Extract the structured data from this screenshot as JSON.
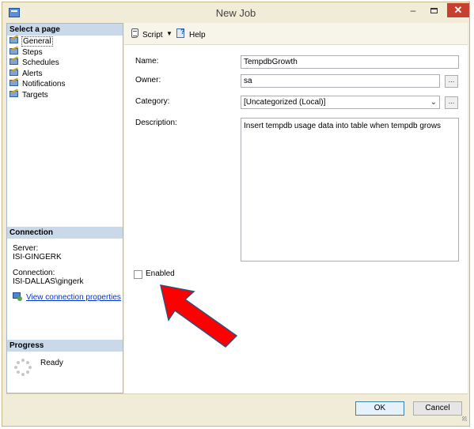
{
  "window": {
    "title": "New Job"
  },
  "title_buttons": {
    "minimize": "–",
    "close": "✕"
  },
  "sidebar": {
    "select_page_header": "Select a page",
    "pages": [
      {
        "label": "General",
        "selected": true
      },
      {
        "label": "Steps",
        "selected": false
      },
      {
        "label": "Schedules",
        "selected": false
      },
      {
        "label": "Alerts",
        "selected": false
      },
      {
        "label": "Notifications",
        "selected": false
      },
      {
        "label": "Targets",
        "selected": false
      }
    ],
    "connection": {
      "header": "Connection",
      "server_label": "Server:",
      "server_value": "ISI-GINGERK",
      "connection_label": "Connection:",
      "connection_value": "ISI-DALLAS\\gingerk",
      "link": "View connection properties"
    },
    "progress": {
      "header": "Progress",
      "status": "Ready"
    }
  },
  "toolbar": {
    "script_label": "Script",
    "help_label": "Help"
  },
  "form": {
    "name_label": "Name:",
    "name_value": "TempdbGrowth",
    "owner_label": "Owner:",
    "owner_value": "sa",
    "category_label": "Category:",
    "category_value": "[Uncategorized (Local)]",
    "description_label": "Description:",
    "description_value": "Insert tempdb usage data into table when tempdb grows",
    "browse_label": "...",
    "enabled_label": "Enabled",
    "enabled_checked": false
  },
  "footer": {
    "ok_label": "OK",
    "cancel_label": "Cancel"
  },
  "icons": {
    "window": "job-window-icon",
    "page": "page-icon",
    "script": "script-icon",
    "help": "help-icon",
    "connection": "connection-properties-icon",
    "progress": "progress-spinner-icon",
    "annotation": "red-arrow-icon"
  },
  "colors": {
    "annotation_arrow": "#ff0000",
    "close_button": "#c7402f",
    "section_header": "#cad9ea"
  }
}
